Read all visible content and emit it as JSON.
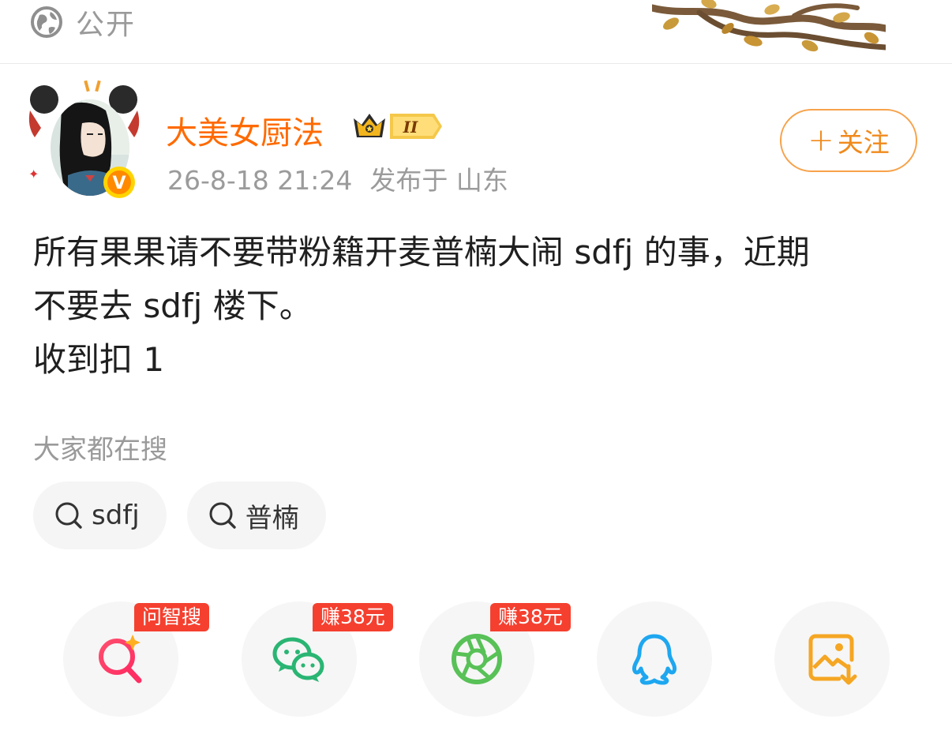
{
  "visibility": {
    "icon": "globe-icon",
    "label": "公开"
  },
  "author": {
    "name": "大美女厨法",
    "badge_level": "II",
    "verified_icon": "v-badge-icon",
    "timestamp": "26-8-18 21:24",
    "location": "发布于 山东"
  },
  "follow": {
    "label": "关注",
    "icon": "plus-icon"
  },
  "post": {
    "lines": [
      "所有果果请不要带粉籍开麦普楠大闹 sdfj 的事，近期",
      "不要去 sdfj 楼下。",
      "收到扣 1"
    ]
  },
  "search": {
    "title": "大家都在搜",
    "chips": [
      {
        "label": "sdfj",
        "icon": "search-icon"
      },
      {
        "label": "普楠",
        "icon": "search-icon"
      }
    ]
  },
  "share": [
    {
      "name": "ai-search",
      "icon": "ai-search-icon",
      "tag": "问智搜"
    },
    {
      "name": "wechat",
      "icon": "wechat-icon",
      "tag": "赚38元"
    },
    {
      "name": "moments",
      "icon": "moments-icon",
      "tag": "赚38元"
    },
    {
      "name": "qq",
      "icon": "qq-icon",
      "tag": ""
    },
    {
      "name": "save-image",
      "icon": "save-image-icon",
      "tag": ""
    }
  ],
  "colors": {
    "username": "#ff6a00",
    "follow": "#f08a1c",
    "tag_bg": "#f5402f",
    "wechat": "#2ab573",
    "moments": "#58c157",
    "qq": "#1ea7f0",
    "save": "#f5a623"
  }
}
